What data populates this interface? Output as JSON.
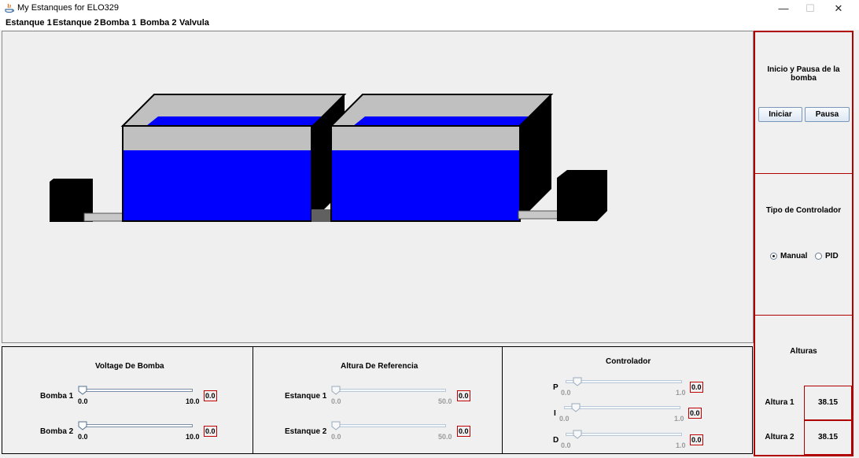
{
  "window": {
    "title": "My Estanques for ELO329",
    "minimize": "—",
    "maximize": "☐",
    "close": "✕"
  },
  "menu": [
    "Estanque 1",
    "Estanque 2",
    "Bomba 1",
    "Bomba 2",
    "Valvula"
  ],
  "colors": {
    "water": "#0000ff",
    "tank_top": "#c0c0c0",
    "tank_side": "#000000",
    "panel_border": "#b00000"
  },
  "side": {
    "pump_title": "Inicio y Pausa de la bomba",
    "start_label": "Iniciar",
    "pause_label": "Pausa",
    "controller_title": "Tipo de Controlador",
    "manual_label": "Manual",
    "pid_label": "PID",
    "selected_controller": "Manual",
    "heights_title": "Alturas",
    "heights": [
      {
        "label": "Altura 1",
        "value": "38.15"
      },
      {
        "label": "Altura 2",
        "value": "38.15"
      }
    ]
  },
  "panels": {
    "voltage": {
      "title": "Voltage De Bomba",
      "rows": [
        {
          "label": "Bomba 1",
          "min": "0.0",
          "max": "10.0",
          "value": "0.0",
          "fraction": 0
        },
        {
          "label": "Bomba 2",
          "min": "0.0",
          "max": "10.0",
          "value": "0.0",
          "fraction": 0
        }
      ]
    },
    "reference": {
      "title": "Altura De Referencia",
      "rows": [
        {
          "label": "Estanque 1",
          "min": "0.0",
          "max": "50.0",
          "value": "0.0",
          "fraction": 0
        },
        {
          "label": "Estanque 2",
          "min": "0.0",
          "max": "50.0",
          "value": "0.0",
          "fraction": 0
        }
      ]
    },
    "controller": {
      "title": "Controlador",
      "rows": [
        {
          "label": "P",
          "min": "0.0",
          "max": "1.0",
          "value": "0.0",
          "fraction": 0
        },
        {
          "label": "I",
          "min": "0.0",
          "max": "1.0",
          "value": "0.0",
          "fraction": 0
        },
        {
          "label": "D",
          "min": "0.0",
          "max": "1.0",
          "value": "0.0",
          "fraction": 0
        }
      ]
    }
  }
}
